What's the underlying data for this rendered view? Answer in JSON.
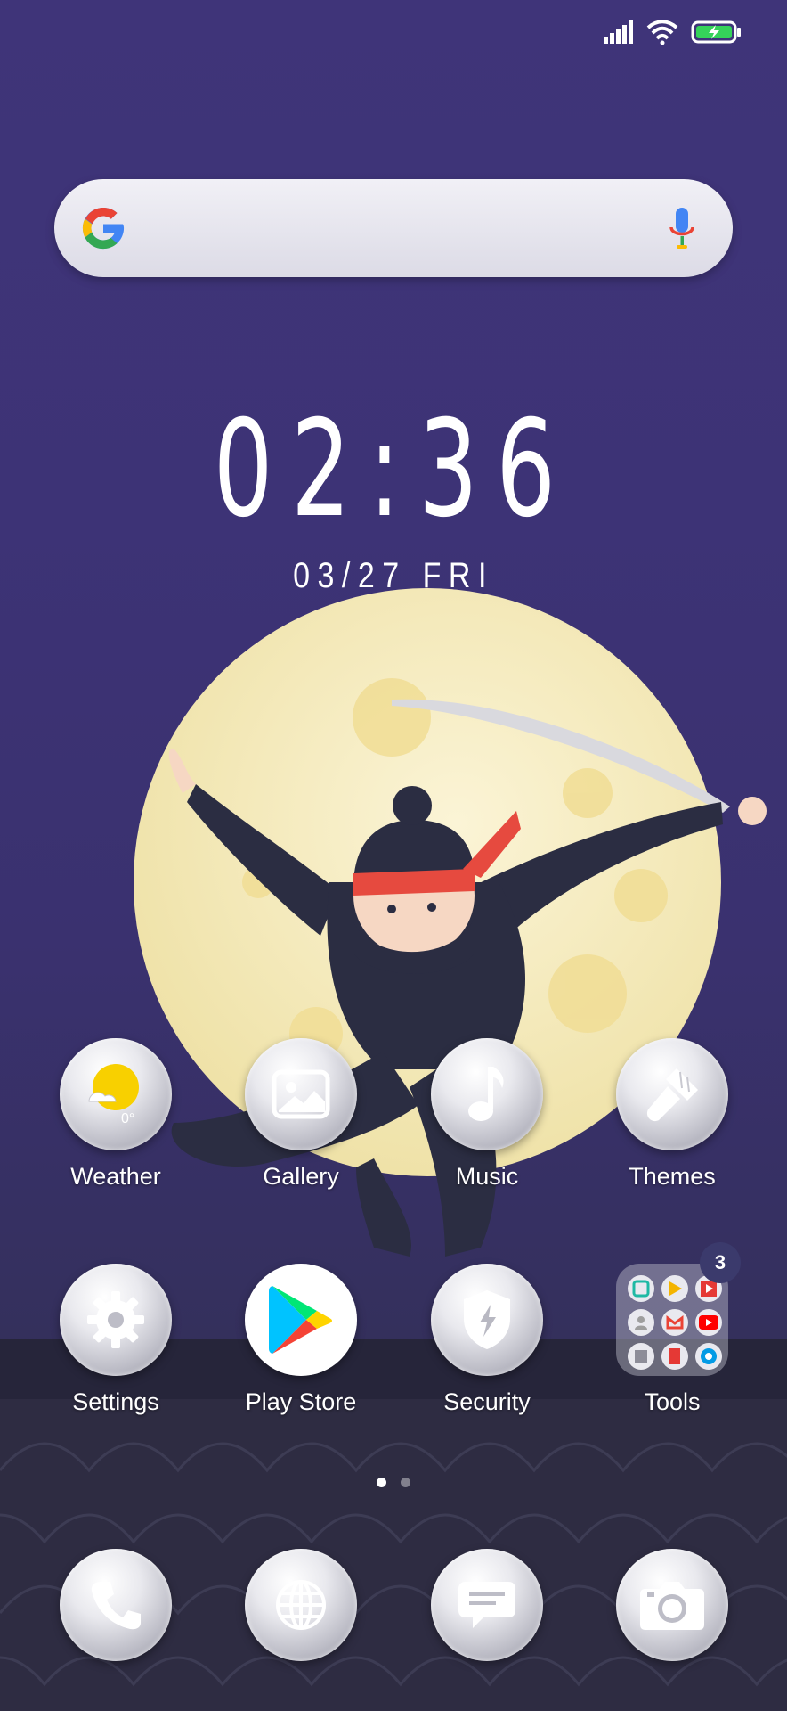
{
  "search": {
    "provider_icon": "google-g-icon",
    "mic_icon": "microphone-icon"
  },
  "status_bar": {
    "icons": [
      "signal-icon",
      "wifi-icon",
      "battery-charging-icon"
    ]
  },
  "clock": {
    "time": "02:36",
    "date": "03/27  FRI"
  },
  "apps": [
    {
      "label": "Weather",
      "icon": "weather-icon",
      "temp": "0°"
    },
    {
      "label": "Gallery",
      "icon": "gallery-icon"
    },
    {
      "label": "Music",
      "icon": "music-note-icon"
    },
    {
      "label": "Themes",
      "icon": "paintbrush-icon"
    },
    {
      "label": "Settings",
      "icon": "gear-icon"
    },
    {
      "label": "Play Store",
      "icon": "play-store-icon"
    },
    {
      "label": "Security",
      "icon": "shield-icon"
    },
    {
      "label": "Tools",
      "icon": "folder-icon",
      "badge": "3"
    }
  ],
  "dock": [
    {
      "icon": "phone-icon"
    },
    {
      "icon": "browser-globe-icon"
    },
    {
      "icon": "messages-icon"
    },
    {
      "icon": "camera-icon"
    }
  ],
  "pages": {
    "count": 2,
    "active": 1
  },
  "colors": {
    "background": "#3f3479",
    "moon": "#f7eec2",
    "headband": "#e64a3f"
  }
}
